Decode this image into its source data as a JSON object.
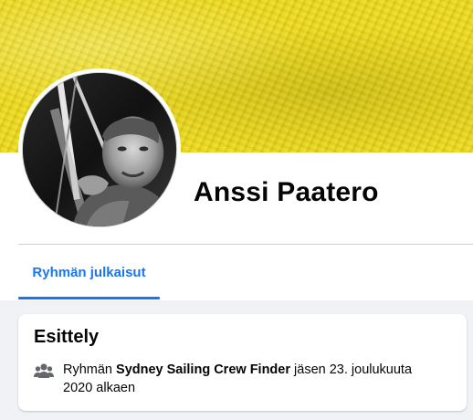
{
  "cover": {
    "color": "#e6d31f"
  },
  "profile": {
    "name": "Anssi Paatero"
  },
  "tabs": [
    {
      "label": "Ryhmän julkaisut",
      "active": true,
      "color": "#1876f2"
    }
  ],
  "intro": {
    "title": "Esittely",
    "membership": {
      "icon": "group-members-icon",
      "prefix": "Ryhmän",
      "group_name": "Sydney Sailing Crew Finder",
      "suffix_line1": "jäsen 23. joulukuuta",
      "suffix_line2": "2020 alkaen"
    }
  }
}
